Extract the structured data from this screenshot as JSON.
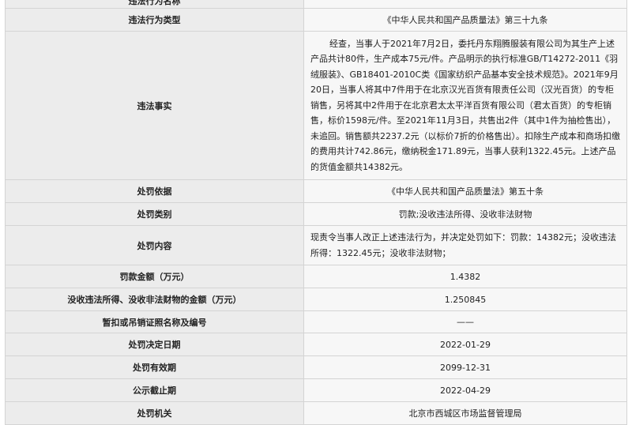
{
  "rows": [
    {
      "label": "违法行为名称",
      "value": ""
    },
    {
      "label": "违法行为类型",
      "value": "《中华人民共和国产品质量法》第三十九条"
    },
    {
      "label": "违法事实",
      "value": "经查，当事人于2021年7月2日，委托丹东翔腾服装有限公司为其生产上述产品共计80件，生产成本75元/件。产品明示的执行标准GB/T14272-2011《羽绒服装》、GB18401-2010C类《国家纺织产品基本安全技术规范》。2021年9月20日，当事人将其中7件用于在北京汉光百货有限责任公司（汉光百货）的专柜销售，另将其中2件用于在北京君太太平洋百货有限公司（君太百货）的专柜销售，标价1598元/件。至2021年11月3日，共售出2件（其中1件为抽检售出），未追回。销售额共2237.2元（以标价7折的价格售出）。扣除生产成本和商场扣缴的费用共计742.86元，缴纳税金171.89元，当事人获利1322.45元。上述产品的货值金额共14382元。"
    },
    {
      "label": "处罚依据",
      "value": "《中华人民共和国产品质量法》第五十条"
    },
    {
      "label": "处罚类别",
      "value": "罚款;没收违法所得、没收非法财物"
    },
    {
      "label": "处罚内容",
      "value": "现责令当事人改正上述违法行为，并决定处罚如下：罚款：14382元；没收违法所得：1322.45元；没收非法财物；"
    },
    {
      "label": "罚款金额（万元）",
      "value": "1.4382"
    },
    {
      "label": "没收违法所得、没收非法财物的金额（万元）",
      "value": "1.250845"
    },
    {
      "label": "暂扣或吊销证照名称及编号",
      "value": "——"
    },
    {
      "label": "处罚决定日期",
      "value": "2022-01-29"
    },
    {
      "label": "处罚有效期",
      "value": "2099-12-31"
    },
    {
      "label": "公示截止期",
      "value": "2022-04-29"
    },
    {
      "label": "处罚机关",
      "value": "北京市西城区市场监督管理局"
    }
  ]
}
